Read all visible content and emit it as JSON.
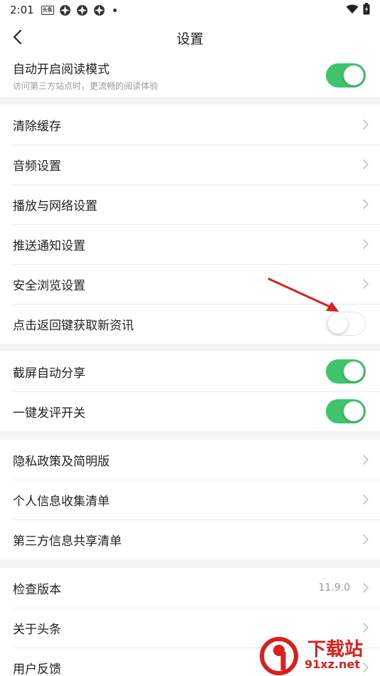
{
  "status_bar": {
    "time": "2:01",
    "news_icon_text": "头条"
  },
  "header": {
    "title": "设置"
  },
  "top_setting": {
    "label": "自动开启阅读模式",
    "description": "访问第三方站点时，更流畅的阅读体验",
    "toggle_on": true
  },
  "group1": [
    {
      "label": "清除缓存",
      "type": "link"
    },
    {
      "label": "音频设置",
      "type": "link"
    },
    {
      "label": "播放与网络设置",
      "type": "link"
    },
    {
      "label": "推送通知设置",
      "type": "link"
    },
    {
      "label": "安全浏览设置",
      "type": "link"
    },
    {
      "label": "点击返回键获取新资讯",
      "type": "toggle",
      "on": false
    }
  ],
  "group2": [
    {
      "label": "截屏自动分享",
      "type": "toggle",
      "on": true
    },
    {
      "label": "一键发评开关",
      "type": "toggle",
      "on": true
    }
  ],
  "group3": [
    {
      "label": "隐私政策及简明版",
      "type": "link"
    },
    {
      "label": "个人信息收集清单",
      "type": "link"
    },
    {
      "label": "第三方信息共享清单",
      "type": "link"
    }
  ],
  "group4": [
    {
      "label": "检查版本",
      "type": "link",
      "value": "11.9.0"
    },
    {
      "label": "关于头条",
      "type": "link"
    },
    {
      "label": "用户反馈",
      "type": "link"
    }
  ],
  "watermark": {
    "text": "下载站",
    "url": "91xz.net"
  },
  "colors": {
    "toggle_on": "#3ec46d",
    "annotation_arrow": "#d8211e"
  }
}
